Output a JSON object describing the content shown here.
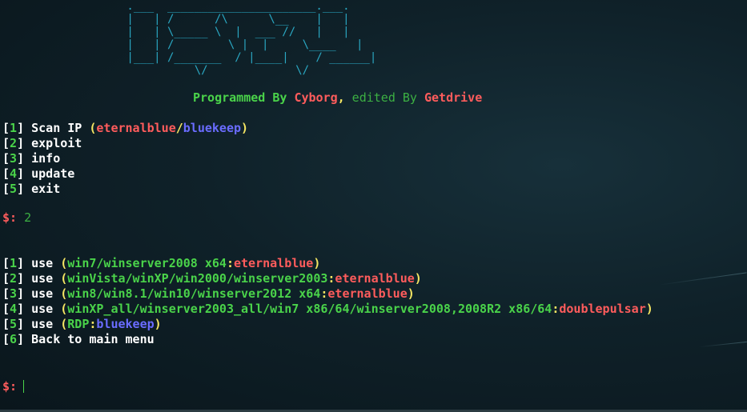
{
  "banner": {
    "ascii": " .___  ______________________.___.\n |   | /      /\\      \\__    |   |\n |   | \\_____ \\  |  ___ //   |   |\n |   | /        \\ |  |     \\____   |\n |___| /_______  / |____|    / ______|\n           \\/             \\/"
  },
  "credit": {
    "prefix": "Programmed By ",
    "author": "Cyborg",
    "comma": ",",
    "edited": " edited By ",
    "editor": "Getdrive"
  },
  "main_menu": [
    {
      "num": "1",
      "label": "Scan IP",
      "extra": [
        {
          "t": "(",
          "c": "y"
        },
        {
          "t": "eternalblue",
          "c": "r"
        },
        {
          "t": "/",
          "c": "y"
        },
        {
          "t": "bluekeep",
          "c": "b"
        },
        {
          "t": ")",
          "c": "y"
        }
      ]
    },
    {
      "num": "2",
      "label": "exploit",
      "extra": []
    },
    {
      "num": "3",
      "label": "info",
      "extra": []
    },
    {
      "num": "4",
      "label": "update",
      "extra": []
    },
    {
      "num": "5",
      "label": "exit",
      "extra": []
    }
  ],
  "prompt1": {
    "symbol": "$:",
    "input": "2"
  },
  "exploit_menu": [
    {
      "num": "1",
      "segments": [
        {
          "t": "use ",
          "c": "w"
        },
        {
          "t": "(",
          "c": "y"
        },
        {
          "t": "win7/winserver2008 x64",
          "c": "g"
        },
        {
          "t": ":",
          "c": "y"
        },
        {
          "t": "eternalblue",
          "c": "r"
        },
        {
          "t": ")",
          "c": "y"
        }
      ]
    },
    {
      "num": "2",
      "segments": [
        {
          "t": "use ",
          "c": "w"
        },
        {
          "t": "(",
          "c": "y"
        },
        {
          "t": "winVista/winXP/win2000/winserver2003",
          "c": "g"
        },
        {
          "t": ":",
          "c": "y"
        },
        {
          "t": "eternalblue",
          "c": "r"
        },
        {
          "t": ")",
          "c": "y"
        }
      ]
    },
    {
      "num": "3",
      "segments": [
        {
          "t": "use ",
          "c": "w"
        },
        {
          "t": "(",
          "c": "y"
        },
        {
          "t": "win8/win8.1/win10/winserver2012 x64",
          "c": "g"
        },
        {
          "t": ":",
          "c": "y"
        },
        {
          "t": "eternalblue",
          "c": "r"
        },
        {
          "t": ")",
          "c": "y"
        }
      ]
    },
    {
      "num": "4",
      "segments": [
        {
          "t": "use ",
          "c": "w"
        },
        {
          "t": "(",
          "c": "y"
        },
        {
          "t": "winXP_all/winserver2003_all/win7 x86/64/winserver2008,2008R2 x86/64",
          "c": "g"
        },
        {
          "t": ":",
          "c": "y"
        },
        {
          "t": "doublepulsar",
          "c": "r"
        },
        {
          "t": ")",
          "c": "y"
        }
      ]
    },
    {
      "num": "5",
      "segments": [
        {
          "t": "use ",
          "c": "w"
        },
        {
          "t": "(",
          "c": "y"
        },
        {
          "t": "RDP",
          "c": "g"
        },
        {
          "t": ":",
          "c": "y"
        },
        {
          "t": "bluekeep",
          "c": "b"
        },
        {
          "t": ")",
          "c": "y"
        }
      ]
    },
    {
      "num": "6",
      "segments": [
        {
          "t": "Back to main menu",
          "c": "w"
        }
      ]
    }
  ],
  "prompt2": {
    "symbol": "$:",
    "input": ""
  },
  "colors": {
    "background": "#0f2129",
    "banner": "#2aa7c2",
    "green": "#4ad34a",
    "red": "#ff5c5c",
    "blue": "#6a6cff",
    "yellow": "#f5e663"
  }
}
